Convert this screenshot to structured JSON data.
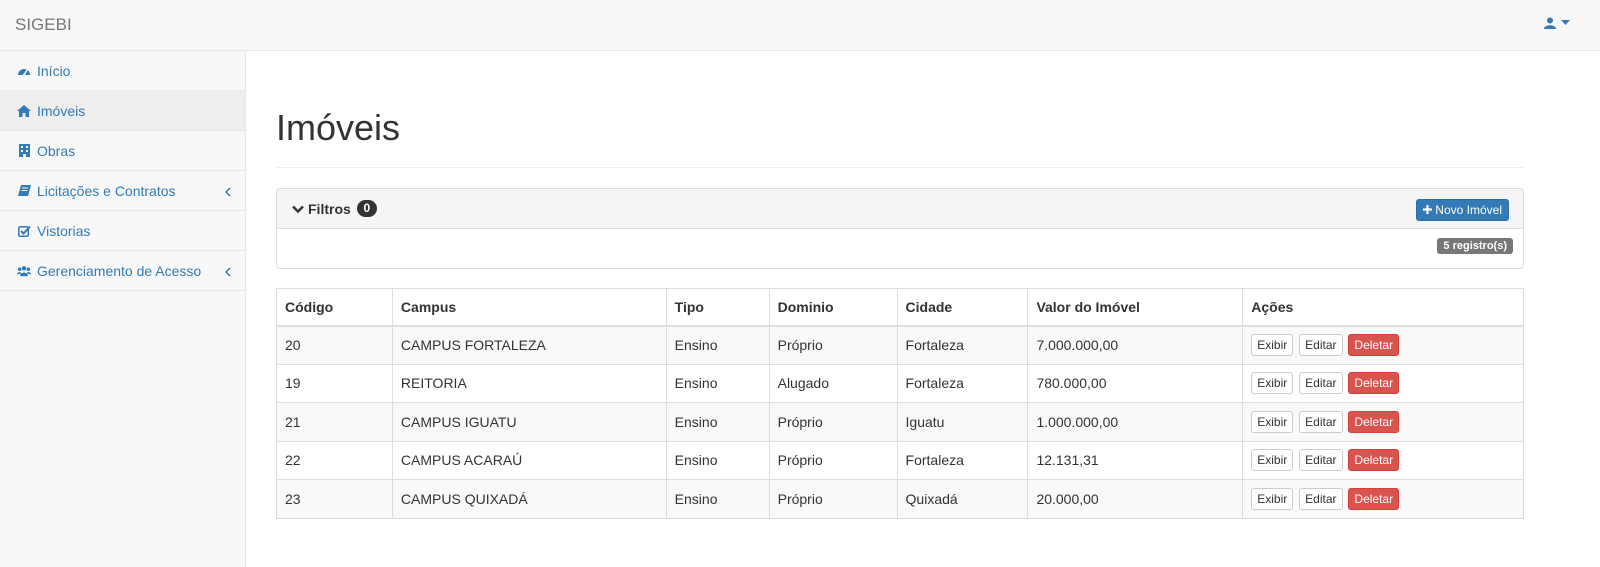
{
  "app": {
    "brand": "SIGEBI"
  },
  "user_menu": {
    "icon": "user-icon",
    "caret": "caret-down-icon"
  },
  "sidebar": {
    "items": [
      {
        "label": "Início",
        "icon": "dashboard-icon",
        "active": false,
        "has_submenu": false
      },
      {
        "label": "Imóveis",
        "icon": "home-icon",
        "active": true,
        "has_submenu": false
      },
      {
        "label": "Obras",
        "icon": "building-icon",
        "active": false,
        "has_submenu": false
      },
      {
        "label": "Licitações e Contratos",
        "icon": "book-icon",
        "active": false,
        "has_submenu": true
      },
      {
        "label": "Vistorias",
        "icon": "check-square-icon",
        "active": false,
        "has_submenu": false
      },
      {
        "label": "Gerenciamento de Acesso",
        "icon": "users-icon",
        "active": false,
        "has_submenu": true
      }
    ]
  },
  "page": {
    "title": "Imóveis"
  },
  "filters": {
    "label": "Filtros",
    "count": "0",
    "new_button": "Novo Imóvel",
    "records_badge": "5 registro(s)"
  },
  "table": {
    "headers": [
      "Código",
      "Campus",
      "Tipo",
      "Dominio",
      "Cidade",
      "Valor do Imóvel",
      "Ações"
    ],
    "actions": {
      "show": "Exibir",
      "edit": "Editar",
      "delete": "Deletar"
    },
    "rows": [
      {
        "codigo": "20",
        "campus": "CAMPUS FORTALEZA",
        "tipo": "Ensino",
        "dominio": "Próprio",
        "cidade": "Fortaleza",
        "valor": "7.000.000,00"
      },
      {
        "codigo": "19",
        "campus": "REITORIA",
        "tipo": "Ensino",
        "dominio": "Alugado",
        "cidade": "Fortaleza",
        "valor": "780.000,00"
      },
      {
        "codigo": "21",
        "campus": "CAMPUS IGUATU",
        "tipo": "Ensino",
        "dominio": "Próprio",
        "cidade": "Iguatu",
        "valor": "1.000.000,00"
      },
      {
        "codigo": "22",
        "campus": "CAMPUS ACARAÚ",
        "tipo": "Ensino",
        "dominio": "Próprio",
        "cidade": "Fortaleza",
        "valor": "12.131,31"
      },
      {
        "codigo": "23",
        "campus": "CAMPUS QUIXADÁ",
        "tipo": "Ensino",
        "dominio": "Próprio",
        "cidade": "Quixadá",
        "valor": "20.000,00"
      }
    ]
  },
  "colors": {
    "link": "#337ab7",
    "primary": "#337ab7",
    "danger": "#d9534f",
    "badge_gray": "#777777"
  }
}
